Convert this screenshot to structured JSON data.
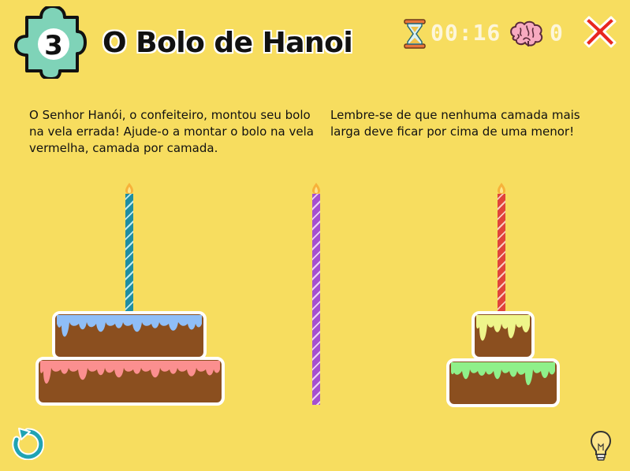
{
  "header": {
    "level_number": "3",
    "title": "O Bolo de Hanoi",
    "timer": "00:16",
    "moves": "0"
  },
  "instructions": {
    "left": "O Senhor Hanói, o confeiteiro, montou seu bolo na vela errada! Ajude-o a montar o bolo na vela vermelha, camada por camada.",
    "right": "Lembre-se de que nenhuma camada mais larga deve ficar por cima de uma menor!"
  },
  "candles": [
    {
      "name": "blue",
      "color": "#1f8ea1",
      "layers": [
        "blue-frosting",
        "pink-frosting"
      ]
    },
    {
      "name": "purple",
      "color": "#a64fcf",
      "layers": []
    },
    {
      "name": "red",
      "color": "#e0433a",
      "layers": [
        "yellow-frosting",
        "green-frosting"
      ]
    }
  ],
  "colors": {
    "background": "#f7dd5f",
    "cake": "#8b4f1f",
    "frosting_blue": "#8fbef7",
    "frosting_pink": "#fb8f8f",
    "frosting_yellow": "#eef58a",
    "frosting_green": "#8ff08a",
    "puzzle": "#7fd3b8",
    "close": "#e8261f",
    "restart": "#1fa3b3"
  },
  "icons": [
    "puzzle-level-icon",
    "hourglass-icon",
    "brain-icon",
    "close-icon",
    "restart-icon",
    "lightbulb-icon"
  ]
}
